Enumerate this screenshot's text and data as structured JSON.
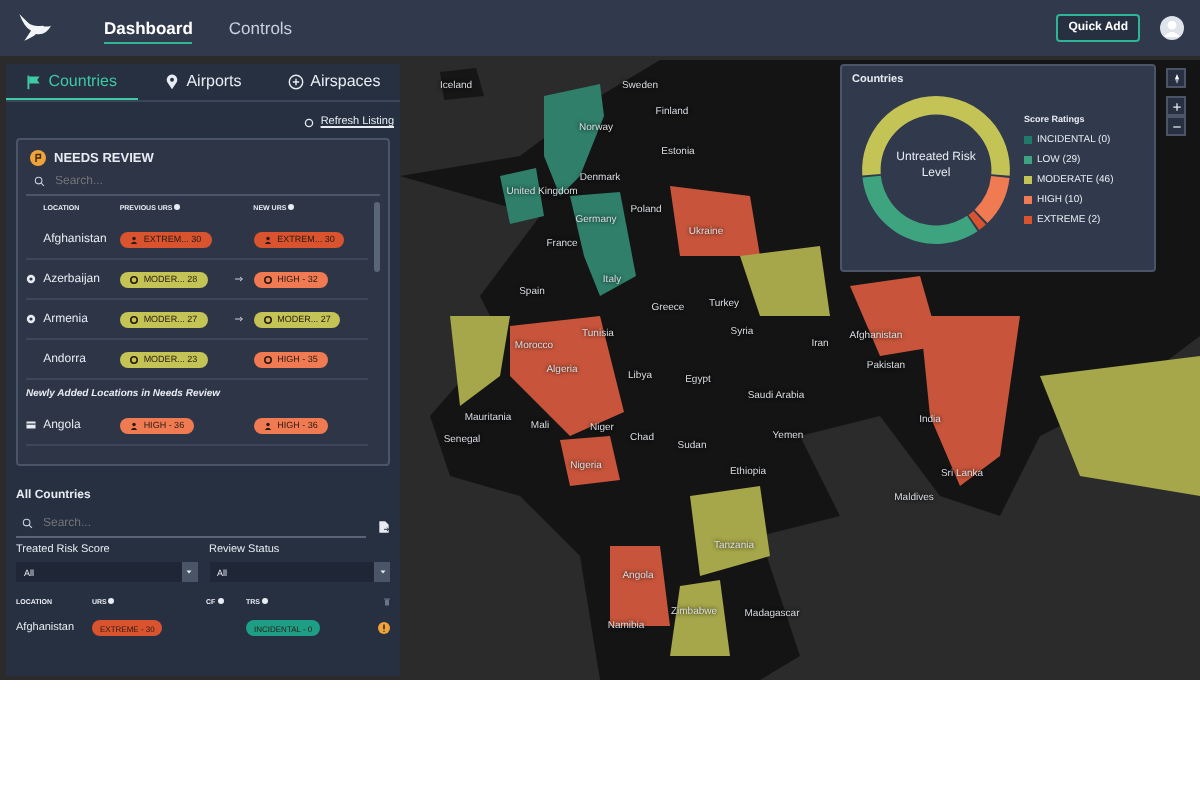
{
  "nav": {
    "items": [
      {
        "label": "Dashboard",
        "selected": true
      },
      {
        "label": "Controls",
        "selected": false
      }
    ],
    "quick_add": "Quick Add"
  },
  "panel": {
    "tabs": [
      {
        "label": "Countries",
        "selected": true
      },
      {
        "label": "Airports",
        "selected": false
      },
      {
        "label": "Airspaces",
        "selected": false
      }
    ],
    "refresh": "Refresh Listing",
    "needs_review": {
      "title": "NEEDS REVIEW",
      "search_placeholder": "Search...",
      "columns": [
        "LOCATION",
        "PREVIOUS URS",
        "NEW URS"
      ],
      "rows": [
        {
          "location": "Afghanistan",
          "kind": "plain",
          "previous": {
            "text": "EXTREM... 30",
            "color": "#d9532f",
            "kind": "person"
          },
          "changed": false,
          "new": {
            "text": "EXTREM... 30",
            "color": "#d9532f",
            "kind": "person"
          }
        },
        {
          "location": "Azerbaijan",
          "kind": "flagged",
          "previous": {
            "text": "MODER... 28",
            "color": "#c3c455",
            "kind": "dial"
          },
          "changed": true,
          "new": {
            "text": "HIGH - 32",
            "color": "#f07b53",
            "kind": "dial"
          }
        },
        {
          "location": "Armenia",
          "kind": "flagged",
          "previous": {
            "text": "MODER... 27",
            "color": "#c3c455",
            "kind": "dial"
          },
          "changed": true,
          "new": {
            "text": "MODER... 27",
            "color": "#c3c455",
            "kind": "dial"
          }
        },
        {
          "location": "Andorra",
          "kind": "plain",
          "previous": {
            "text": "MODER... 23",
            "color": "#c3c455",
            "kind": "dial"
          },
          "changed": false,
          "new": {
            "text": "HIGH - 35",
            "color": "#f07b53",
            "kind": "dial"
          }
        }
      ],
      "newly_added_title": "Newly Added Locations in Needs Review",
      "new_rows": [
        {
          "location": "Angola",
          "kind": "card",
          "previous": {
            "text": "HIGH - 36",
            "color": "#f07b53",
            "kind": "person"
          },
          "changed": false,
          "new": {
            "text": "HIGH - 36",
            "color": "#f07b53",
            "kind": "person"
          }
        }
      ]
    },
    "all_countries": {
      "title": "All Countries",
      "search_placeholder": "Search...",
      "filters": [
        {
          "label": "Treated Risk Score",
          "value": "All"
        },
        {
          "label": "Review Status",
          "value": "All"
        }
      ],
      "columns": [
        "LOCATION",
        "URS",
        "CF",
        "TRS"
      ],
      "rows": [
        {
          "location": "Afghanistan",
          "urs": {
            "text": "EXTREME - 30",
            "color": "#d9532f"
          },
          "trs": {
            "text": "INCIDENTAL - 0",
            "color": "#1f9e86"
          },
          "warning": true
        }
      ]
    }
  },
  "chart_panel": {
    "center_label": "Untreated Risk Level",
    "legend_title": "Score Ratings",
    "legend": [
      {
        "color": "#1f7a6a"
      },
      {
        "color": "#3ea37f"
      },
      {
        "color": "#c3c455"
      },
      {
        "color": "#f07b53"
      },
      {
        "color": "#d9532f"
      }
    ],
    "chart_data": {
      "type": "donut",
      "title": "Countries",
      "categories": [
        "INCIDENTAL (0)",
        "LOW (29)",
        "MODERATE (46)",
        "HIGH (10)",
        "EXTREME (2)"
      ],
      "values": [
        0,
        29,
        46,
        10,
        2
      ]
    }
  },
  "map": {
    "labels": [
      "Iceland",
      "Sweden",
      "Finland",
      "Norway",
      "Estonia",
      "Denmark",
      "United Kingdom",
      "Poland",
      "Germany",
      "Ukraine",
      "France",
      "Italy",
      "Spain",
      "Greece",
      "Turkey",
      "Tunisia",
      "Syria",
      "Iran",
      "Morocco",
      "Algeria",
      "Libya",
      "Egypt",
      "Saudi Arabia",
      "Mauritania",
      "Mali",
      "Niger",
      "Chad",
      "Sudan",
      "Yemen",
      "Senegal",
      "Nigeria",
      "Ethiopia",
      "Tanzania",
      "Angola",
      "Zimbabwe",
      "Namibia",
      "Madagascar",
      "Afghanistan",
      "Pakistan",
      "India",
      "Sri Lanka",
      "Maldives"
    ]
  }
}
